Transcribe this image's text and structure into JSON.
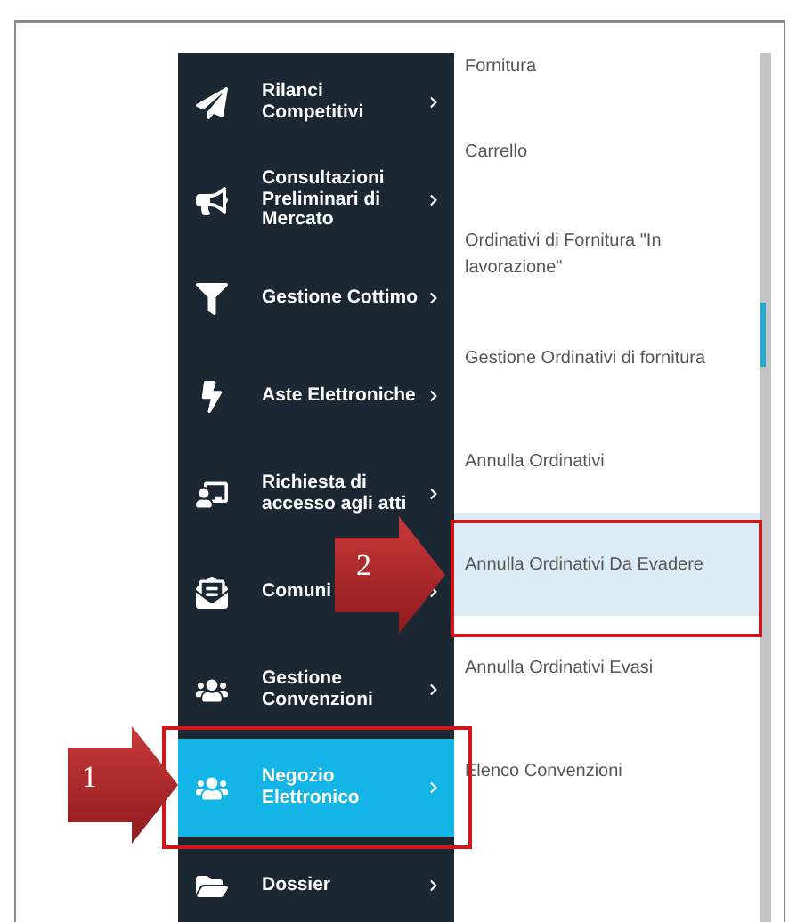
{
  "sidebar": {
    "items": [
      {
        "label": "Rilanci Competitivi",
        "selected": false
      },
      {
        "label": "Consultazioni Preliminari di Mercato",
        "selected": false
      },
      {
        "label": "Gestione Cottimo",
        "selected": false
      },
      {
        "label": "Aste Elettroniche",
        "selected": false
      },
      {
        "label": "Richiesta di accesso agli atti",
        "selected": false
      },
      {
        "label": "Comuni",
        "selected": false
      },
      {
        "label": "Gestione Convenzioni",
        "selected": false
      },
      {
        "label": "Negozio Elettronico",
        "selected": true
      },
      {
        "label": "Dossier",
        "selected": false
      }
    ]
  },
  "submenu": {
    "items": [
      {
        "label": "Fornitura",
        "selected": false
      },
      {
        "label": "Carrello",
        "selected": false
      },
      {
        "label": "Ordinativi di Fornitura \"In lavorazione\"",
        "selected": false
      },
      {
        "label": "Gestione Ordinativi di fornitura",
        "selected": false
      },
      {
        "label": "Annulla Ordinativi",
        "selected": false
      },
      {
        "label": "Annulla Ordinativi Da Evadere",
        "selected": true
      },
      {
        "label": "Annulla Ordinativi Evasi",
        "selected": false
      },
      {
        "label": "Elenco Convenzioni",
        "selected": false
      }
    ]
  },
  "annotations": [
    {
      "number": "1"
    },
    {
      "number": "2"
    }
  ]
}
